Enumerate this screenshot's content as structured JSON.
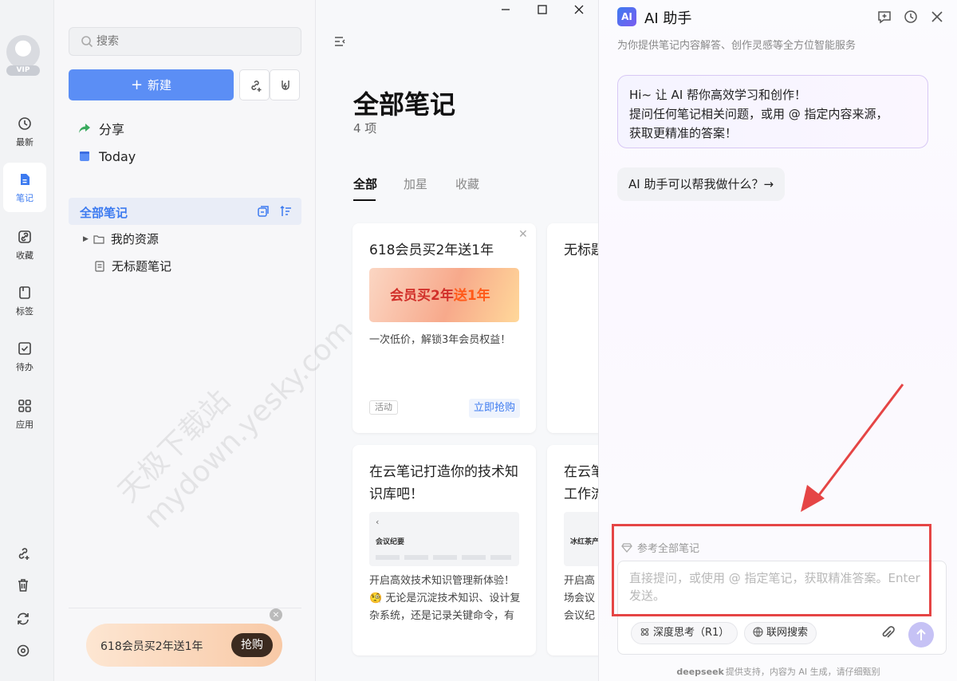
{
  "rail": {
    "vip_label": "VIP",
    "items": [
      {
        "label": "最新",
        "icon": "clock-icon"
      },
      {
        "label": "笔记",
        "icon": "note-icon"
      },
      {
        "label": "收藏",
        "icon": "link-icon"
      },
      {
        "label": "标签",
        "icon": "bookmark-icon"
      },
      {
        "label": "待办",
        "icon": "checkbox-icon"
      },
      {
        "label": "应用",
        "icon": "apps-grid-icon"
      }
    ],
    "bottom_icons": [
      "link-add-icon",
      "trash-icon",
      "sync-icon",
      "settings-icon"
    ]
  },
  "sidebar": {
    "search_placeholder": "搜索",
    "new_button": "新建",
    "nav": [
      {
        "label": "分享",
        "icon": "share-arrow-icon"
      },
      {
        "label": "Today",
        "icon": "calendar-icon"
      }
    ],
    "section_title": "全部笔记",
    "tree": [
      {
        "label": "我的资源",
        "icon": "folder-icon"
      },
      {
        "label": "无标题笔记",
        "icon": "document-icon"
      }
    ],
    "promo": {
      "text": "618会员买2年送1年",
      "button": "抢购"
    }
  },
  "main": {
    "title": "全部笔记",
    "count": "4 项",
    "tabs": [
      "全部",
      "加星",
      "收藏"
    ],
    "cards": [
      {
        "title": "618会员买2年送1年",
        "banner_text_a": "会员买2年",
        "banner_text_b": "送1年",
        "desc": "一次低价，解锁3年会员权益！",
        "tag": "活动",
        "action": "立即抢购"
      },
      {
        "title": "无标题"
      },
      {
        "title": "在云笔记打造你的技术知识库吧！",
        "preview_heading": "会议纪要",
        "desc": "开启高效技术知识管理新体验！ 🧐 无论是沉淀技术知识、设计复杂系统，还是记录关键命令，有道云笔记都愿成为你"
      },
      {
        "title": "在云笔工作流",
        "preview_heading": "冰红茶产",
        "desc": "开启高场会议会议纪有备"
      }
    ]
  },
  "ai": {
    "logo": "AI",
    "title": "AI 助手",
    "subtitle": "为你提供笔记内容解答、创作灵感等全方位智能服务",
    "greeting": [
      "Hi~ 让 AI 帮你高效学习和创作！",
      "提问任何笔记相关问题，或用 @ 指定内容来源，",
      "获取更精准的答案！"
    ],
    "suggestion": "AI 助手可以帮我做什么？→",
    "reference": "参考全部笔记",
    "input_placeholder": "直接提问，或使用 @ 指定笔记，获取精准答案。Enter 发送。",
    "deep_think": "深度思考（R1）",
    "web_search": "联网搜索",
    "footer_brand": "deepseek",
    "footer_text": "提供支持，内容为 AI 生成，请仔细甄别"
  },
  "watermark": "天极下载站\nmydown.yesky.com",
  "colors": {
    "accent": "#3d7bf0",
    "annotation": "#e54545",
    "send": "#c6c2f5"
  }
}
